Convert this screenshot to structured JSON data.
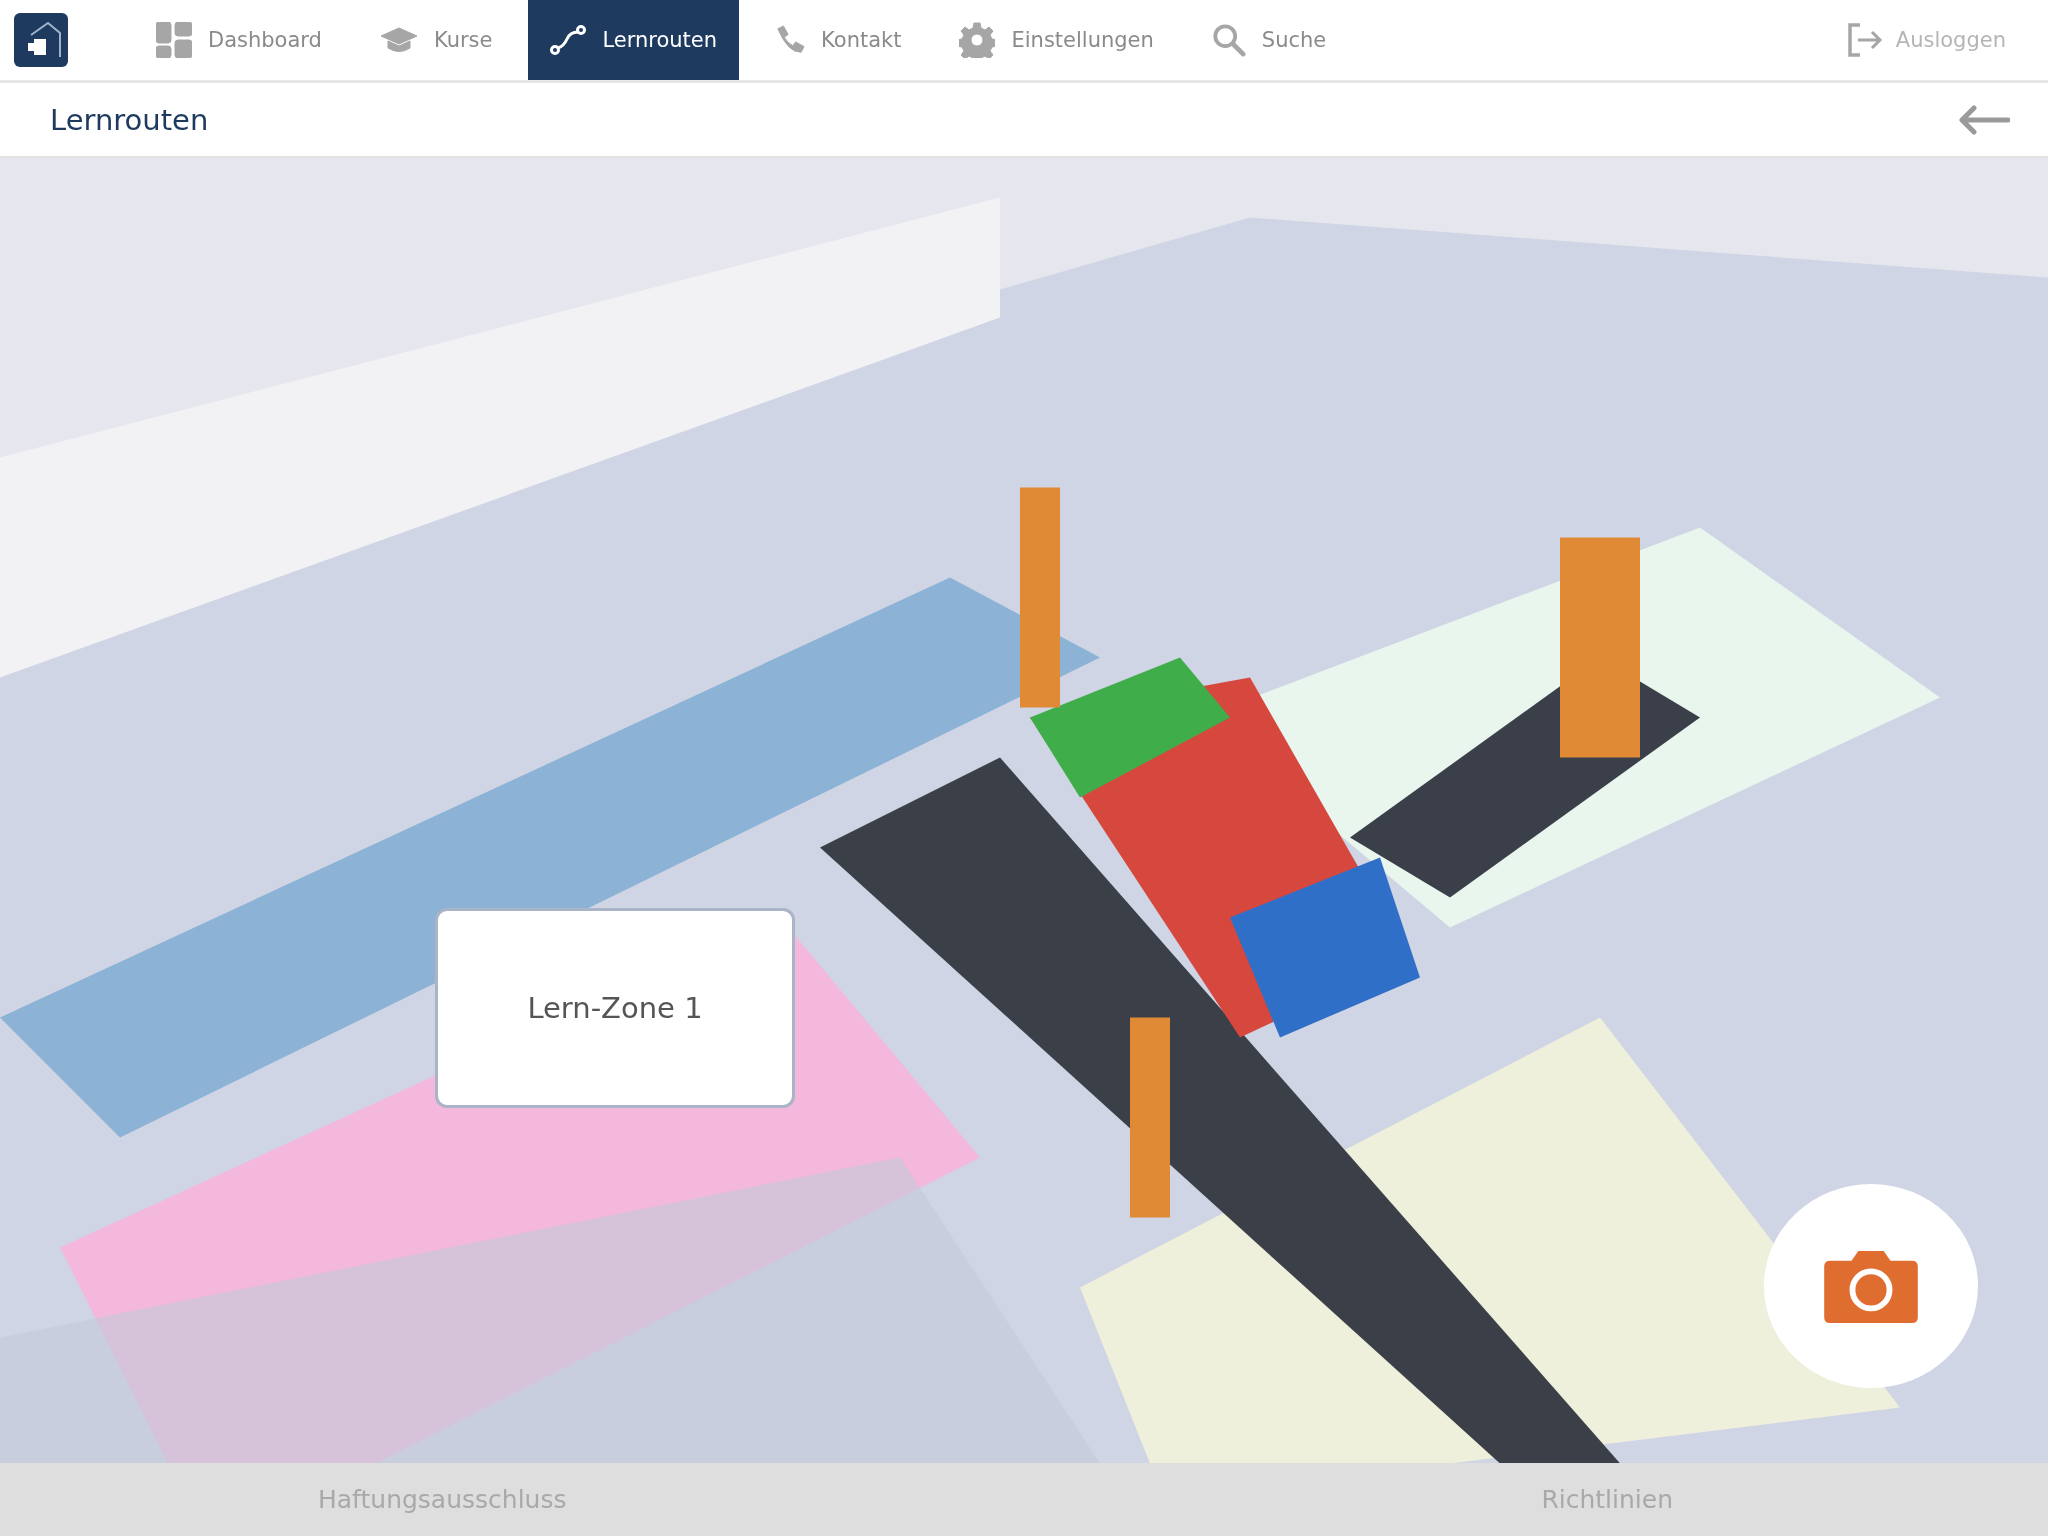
{
  "nav": {
    "items": [
      {
        "label": "Dashboard",
        "kind": "dashboard",
        "selected": false
      },
      {
        "label": "Kurse",
        "kind": "courses",
        "selected": false
      },
      {
        "label": "Lernrouten",
        "kind": "route",
        "selected": true
      },
      {
        "label": "Kontakt",
        "kind": "contact",
        "selected": false
      },
      {
        "label": "Einstellungen",
        "kind": "settings",
        "selected": false
      },
      {
        "label": "Suche",
        "kind": "search",
        "selected": false
      }
    ],
    "logout": "Ausloggen"
  },
  "page": {
    "title": "Lernrouten"
  },
  "map": {
    "kind": "picture",
    "zone_label": "Lern-Zone 1"
  },
  "footer": {
    "links": [
      "Haftungsausschluss",
      "Richtlinien"
    ]
  }
}
